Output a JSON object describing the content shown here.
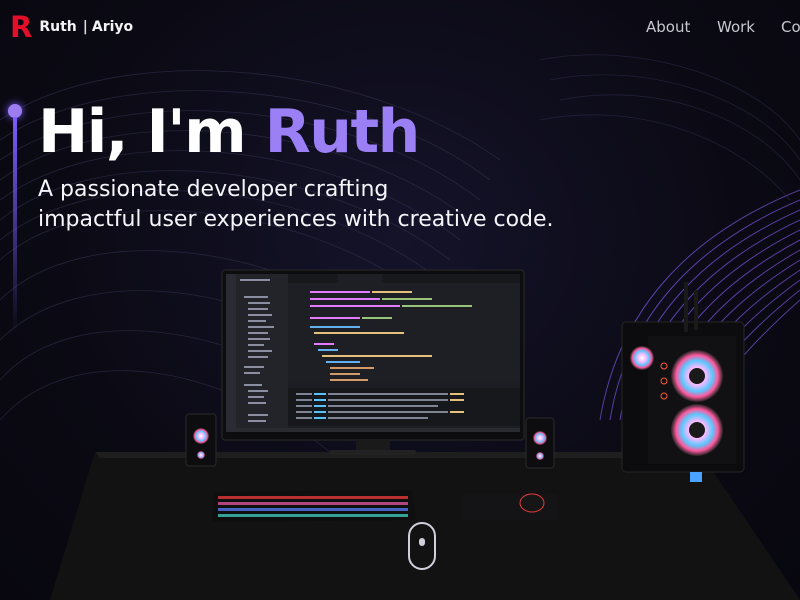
{
  "header": {
    "logo_mark": "R",
    "logo_first": "Ruth",
    "logo_sep": "|",
    "logo_last": "Ariyo",
    "nav": [
      {
        "label": "About"
      },
      {
        "label": "Work"
      },
      {
        "label": "Co"
      }
    ]
  },
  "hero": {
    "greeting": "Hi, I'm ",
    "name": "Ruth",
    "subtitle_line1": "A passionate developer crafting",
    "subtitle_line2": "impactful user experiences with creative code."
  },
  "scene": {
    "description_icons": [
      "desk-setup-illustration",
      "monitor-icon",
      "pc-tower-icon",
      "speaker-icon",
      "keyboard-icon",
      "mouse-icon"
    ]
  },
  "colors": {
    "accent": "#9b7ff5",
    "brand_red": "#e30e2a",
    "background": "#0b0a14"
  }
}
